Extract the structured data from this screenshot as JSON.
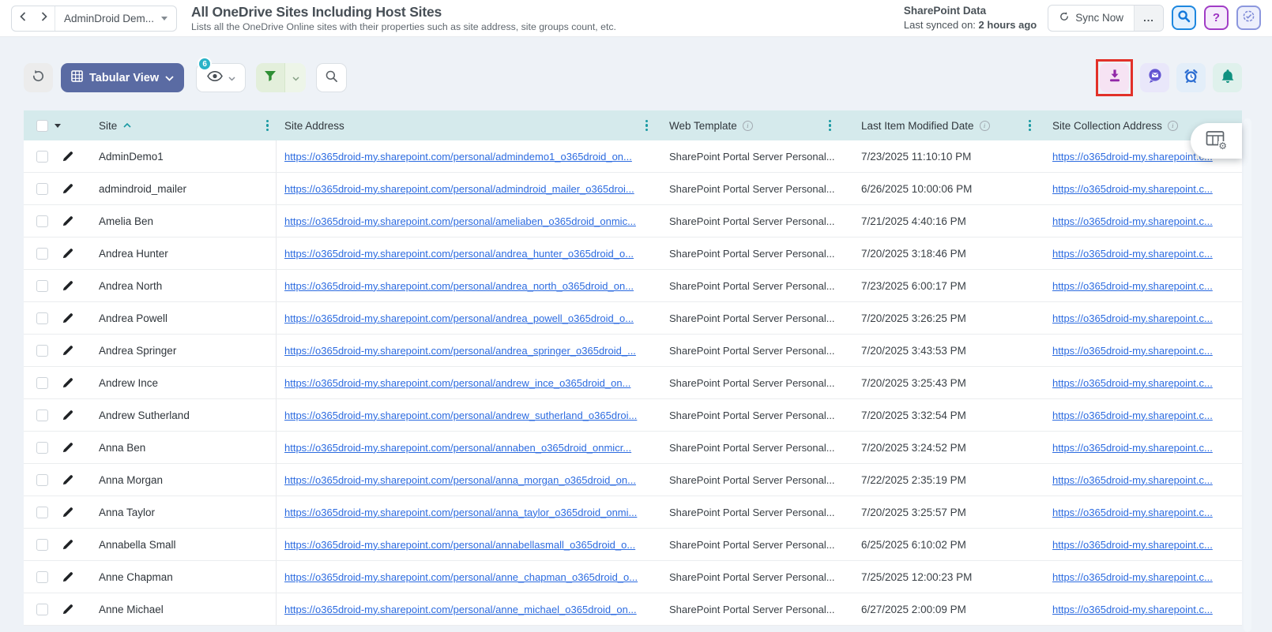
{
  "header": {
    "workspace_label": "AdminDroid Dem...",
    "title": "All OneDrive Sites Including Host Sites",
    "subtitle": "Lists all the OneDrive Online sites with their properties such as site address, site groups count, etc.",
    "sync_source": "SharePoint Data",
    "last_synced_prefix": "Last synced on: ",
    "last_synced_time": "2 hours ago",
    "sync_now_label": "Sync Now",
    "more_label": "..."
  },
  "toolbar": {
    "view_label": "Tabular View",
    "views_badge_count": "6"
  },
  "table": {
    "columns": [
      "Site",
      "Site Address",
      "Web Template",
      "Last Item Modified Date",
      "Site Collection Address"
    ],
    "rows": [
      {
        "site": "AdminDemo1",
        "address": "https://o365droid-my.sharepoint.com/personal/admindemo1_o365droid_on...",
        "template": "SharePoint Portal Server Personal...",
        "modified": "7/23/2025 11:10:10 PM",
        "collection": "https://o365droid-my.sharepoint.c..."
      },
      {
        "site": "admindroid_mailer",
        "address": "https://o365droid-my.sharepoint.com/personal/admindroid_mailer_o365droi...",
        "template": "SharePoint Portal Server Personal...",
        "modified": "6/26/2025 10:00:06 PM",
        "collection": "https://o365droid-my.sharepoint.c..."
      },
      {
        "site": "Amelia Ben",
        "address": "https://o365droid-my.sharepoint.com/personal/ameliaben_o365droid_onmic...",
        "template": "SharePoint Portal Server Personal...",
        "modified": "7/21/2025 4:40:16 PM",
        "collection": "https://o365droid-my.sharepoint.c..."
      },
      {
        "site": "Andrea Hunter",
        "address": "https://o365droid-my.sharepoint.com/personal/andrea_hunter_o365droid_o...",
        "template": "SharePoint Portal Server Personal...",
        "modified": "7/20/2025 3:18:46 PM",
        "collection": "https://o365droid-my.sharepoint.c..."
      },
      {
        "site": "Andrea North",
        "address": "https://o365droid-my.sharepoint.com/personal/andrea_north_o365droid_on...",
        "template": "SharePoint Portal Server Personal...",
        "modified": "7/23/2025 6:00:17 PM",
        "collection": "https://o365droid-my.sharepoint.c..."
      },
      {
        "site": "Andrea Powell",
        "address": "https://o365droid-my.sharepoint.com/personal/andrea_powell_o365droid_o...",
        "template": "SharePoint Portal Server Personal...",
        "modified": "7/20/2025 3:26:25 PM",
        "collection": "https://o365droid-my.sharepoint.c..."
      },
      {
        "site": "Andrea Springer",
        "address": "https://o365droid-my.sharepoint.com/personal/andrea_springer_o365droid_...",
        "template": "SharePoint Portal Server Personal...",
        "modified": "7/20/2025 3:43:53 PM",
        "collection": "https://o365droid-my.sharepoint.c..."
      },
      {
        "site": "Andrew Ince",
        "address": "https://o365droid-my.sharepoint.com/personal/andrew_ince_o365droid_on...",
        "template": "SharePoint Portal Server Personal...",
        "modified": "7/20/2025 3:25:43 PM",
        "collection": "https://o365droid-my.sharepoint.c..."
      },
      {
        "site": "Andrew Sutherland",
        "address": "https://o365droid-my.sharepoint.com/personal/andrew_sutherland_o365droi...",
        "template": "SharePoint Portal Server Personal...",
        "modified": "7/20/2025 3:32:54 PM",
        "collection": "https://o365droid-my.sharepoint.c..."
      },
      {
        "site": "Anna Ben",
        "address": "https://o365droid-my.sharepoint.com/personal/annaben_o365droid_onmicr...",
        "template": "SharePoint Portal Server Personal...",
        "modified": "7/20/2025 3:24:52 PM",
        "collection": "https://o365droid-my.sharepoint.c..."
      },
      {
        "site": "Anna Morgan",
        "address": "https://o365droid-my.sharepoint.com/personal/anna_morgan_o365droid_on...",
        "template": "SharePoint Portal Server Personal...",
        "modified": "7/22/2025 2:35:19 PM",
        "collection": "https://o365droid-my.sharepoint.c..."
      },
      {
        "site": "Anna Taylor",
        "address": "https://o365droid-my.sharepoint.com/personal/anna_taylor_o365droid_onmi...",
        "template": "SharePoint Portal Server Personal...",
        "modified": "7/20/2025 3:25:57 PM",
        "collection": "https://o365droid-my.sharepoint.c..."
      },
      {
        "site": "Annabella Small",
        "address": "https://o365droid-my.sharepoint.com/personal/annabellasmall_o365droid_o...",
        "template": "SharePoint Portal Server Personal...",
        "modified": "6/25/2025 6:10:02 PM",
        "collection": "https://o365droid-my.sharepoint.c..."
      },
      {
        "site": "Anne Chapman",
        "address": "https://o365droid-my.sharepoint.com/personal/anne_chapman_o365droid_o...",
        "template": "SharePoint Portal Server Personal...",
        "modified": "7/25/2025 12:00:23 PM",
        "collection": "https://o365droid-my.sharepoint.c..."
      },
      {
        "site": "Anne Michael",
        "address": "https://o365droid-my.sharepoint.com/personal/anne_michael_o365droid_on...",
        "template": "SharePoint Portal Server Personal...",
        "modified": "6/27/2025 2:00:09 PM",
        "collection": "https://o365droid-my.sharepoint.c..."
      }
    ]
  },
  "colors": {
    "link_blue": "#2c6be0",
    "table_header_bg": "#d5eaec",
    "teal_accent": "#1a9aa3",
    "view_button_bg": "#5a6ba3",
    "badge_cyan": "#28b2c7",
    "filter_green": "#2f8f35",
    "download_purple": "#9228a8",
    "annotation_red": "#e23129",
    "chat_purple": "#6355d2",
    "alarm_blue": "#2e6fd2",
    "bell_teal": "#0f9180",
    "search_blue": "#1478db",
    "help_purple": "#9c2fc0"
  }
}
